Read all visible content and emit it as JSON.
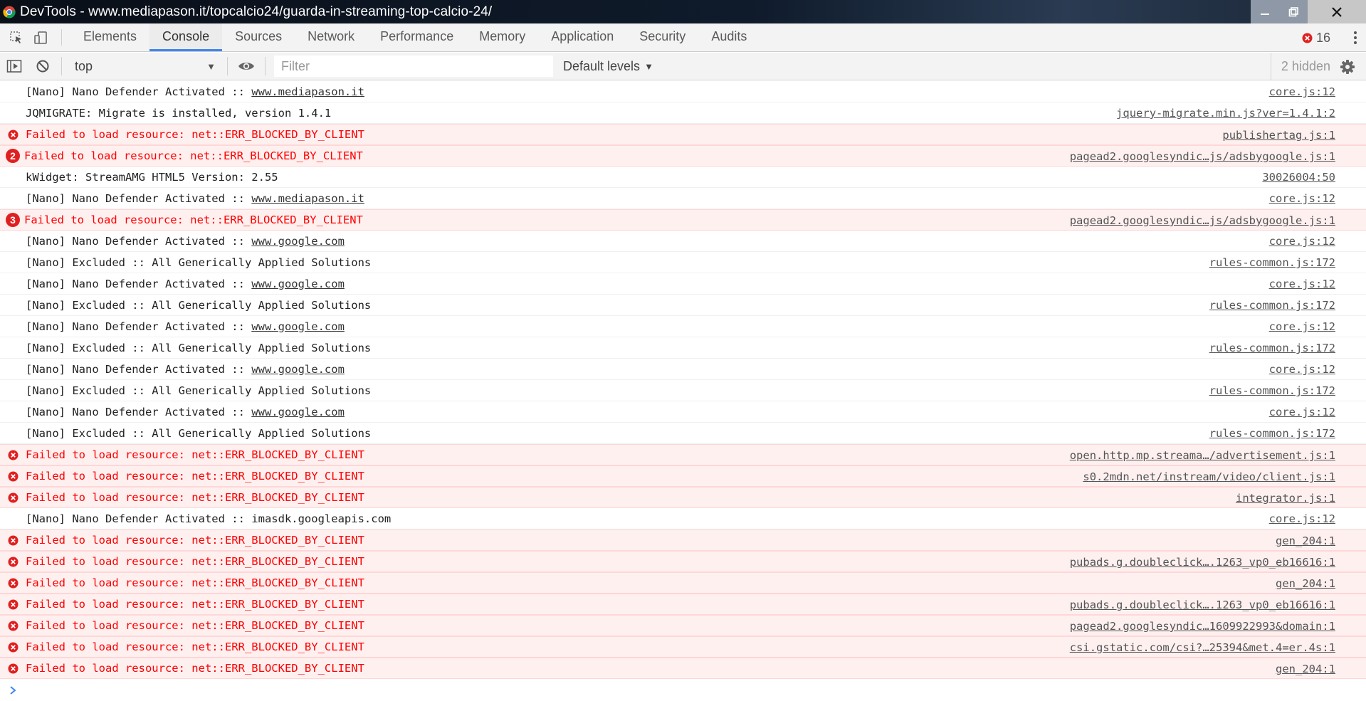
{
  "window": {
    "title": "DevTools - www.mediapason.it/topcalcio24/guarda-in-streaming-top-calcio-24/"
  },
  "tabs": [
    {
      "label": "Elements",
      "active": false
    },
    {
      "label": "Console",
      "active": true
    },
    {
      "label": "Sources",
      "active": false
    },
    {
      "label": "Network",
      "active": false
    },
    {
      "label": "Performance",
      "active": false
    },
    {
      "label": "Memory",
      "active": false
    },
    {
      "label": "Application",
      "active": false
    },
    {
      "label": "Security",
      "active": false
    },
    {
      "label": "Audits",
      "active": false
    }
  ],
  "error_count": "16",
  "toolbar": {
    "context": "top",
    "filter_placeholder": "Filter",
    "levels": "Default levels",
    "hidden": "2 hidden"
  },
  "colors": {
    "accent": "#3d86f5",
    "error": "#ff0000",
    "error_bg": "#fff0f0",
    "error_icon": "#e02020"
  },
  "log": [
    {
      "level": "info",
      "text": "[Nano] Nano Defender Activated :: ",
      "link": "www.mediapason.it",
      "source": "core.js:12"
    },
    {
      "level": "info",
      "text": "JQMIGRATE: Migrate is installed, version 1.4.1",
      "link": "",
      "source": "jquery-migrate.min.js?ver=1.4.1:2"
    },
    {
      "level": "error",
      "count": "",
      "text": "Failed to load resource: net::ERR_BLOCKED_BY_CLIENT",
      "link": "",
      "source": "publishertag.js:1"
    },
    {
      "level": "error",
      "count": "2",
      "text": "Failed to load resource: net::ERR_BLOCKED_BY_CLIENT",
      "link": "",
      "source": "pagead2.googlesyndic…js/adsbygoogle.js:1"
    },
    {
      "level": "info",
      "text": "kWidget: StreamAMG HTML5 Version: 2.55",
      "link": "",
      "source": "30026004:50"
    },
    {
      "level": "info",
      "text": "[Nano] Nano Defender Activated :: ",
      "link": "www.mediapason.it",
      "source": "core.js:12"
    },
    {
      "level": "error",
      "count": "3",
      "text": "Failed to load resource: net::ERR_BLOCKED_BY_CLIENT",
      "link": "",
      "source": "pagead2.googlesyndic…js/adsbygoogle.js:1"
    },
    {
      "level": "info",
      "text": "[Nano] Nano Defender Activated :: ",
      "link": "www.google.com",
      "source": "core.js:12"
    },
    {
      "level": "info",
      "text": "[Nano] Excluded :: All Generically Applied Solutions",
      "link": "",
      "source": "rules-common.js:172"
    },
    {
      "level": "info",
      "text": "[Nano] Nano Defender Activated :: ",
      "link": "www.google.com",
      "source": "core.js:12"
    },
    {
      "level": "info",
      "text": "[Nano] Excluded :: All Generically Applied Solutions",
      "link": "",
      "source": "rules-common.js:172"
    },
    {
      "level": "info",
      "text": "[Nano] Nano Defender Activated :: ",
      "link": "www.google.com",
      "source": "core.js:12"
    },
    {
      "level": "info",
      "text": "[Nano] Excluded :: All Generically Applied Solutions",
      "link": "",
      "source": "rules-common.js:172"
    },
    {
      "level": "info",
      "text": "[Nano] Nano Defender Activated :: ",
      "link": "www.google.com",
      "source": "core.js:12"
    },
    {
      "level": "info",
      "text": "[Nano] Excluded :: All Generically Applied Solutions",
      "link": "",
      "source": "rules-common.js:172"
    },
    {
      "level": "info",
      "text": "[Nano] Nano Defender Activated :: ",
      "link": "www.google.com",
      "source": "core.js:12"
    },
    {
      "level": "info",
      "text": "[Nano] Excluded :: All Generically Applied Solutions",
      "link": "",
      "source": "rules-common.js:172"
    },
    {
      "level": "error",
      "count": "",
      "text": "Failed to load resource: net::ERR_BLOCKED_BY_CLIENT",
      "link": "",
      "source": "open.http.mp.streama…/advertisement.js:1"
    },
    {
      "level": "error",
      "count": "",
      "text": "Failed to load resource: net::ERR_BLOCKED_BY_CLIENT",
      "link": "",
      "source": "s0.2mdn.net/instream/video/client.js:1"
    },
    {
      "level": "error",
      "count": "",
      "text": "Failed to load resource: net::ERR_BLOCKED_BY_CLIENT",
      "link": "",
      "source": "integrator.js:1"
    },
    {
      "level": "info",
      "text": "[Nano] Nano Defender Activated :: imasdk.googleapis.com",
      "link": "",
      "source": "core.js:12"
    },
    {
      "level": "error",
      "count": "",
      "text": "Failed to load resource: net::ERR_BLOCKED_BY_CLIENT",
      "link": "",
      "source": "gen_204:1"
    },
    {
      "level": "error",
      "count": "",
      "text": "Failed to load resource: net::ERR_BLOCKED_BY_CLIENT",
      "link": "",
      "source": "pubads.g.doubleclick….1263_vp0_eb16616:1"
    },
    {
      "level": "error",
      "count": "",
      "text": "Failed to load resource: net::ERR_BLOCKED_BY_CLIENT",
      "link": "",
      "source": "gen_204:1"
    },
    {
      "level": "error",
      "count": "",
      "text": "Failed to load resource: net::ERR_BLOCKED_BY_CLIENT",
      "link": "",
      "source": "pubads.g.doubleclick….1263_vp0_eb16616:1"
    },
    {
      "level": "error",
      "count": "",
      "text": "Failed to load resource: net::ERR_BLOCKED_BY_CLIENT",
      "link": "",
      "source": "pagead2.googlesyndic…1609922993&domain:1"
    },
    {
      "level": "error",
      "count": "",
      "text": "Failed to load resource: net::ERR_BLOCKED_BY_CLIENT",
      "link": "",
      "source": "csi.gstatic.com/csi?…25394&met.4=er.4s:1"
    },
    {
      "level": "error",
      "count": "",
      "text": "Failed to load resource: net::ERR_BLOCKED_BY_CLIENT",
      "link": "",
      "source": "gen_204:1"
    }
  ],
  "prompt": ">"
}
